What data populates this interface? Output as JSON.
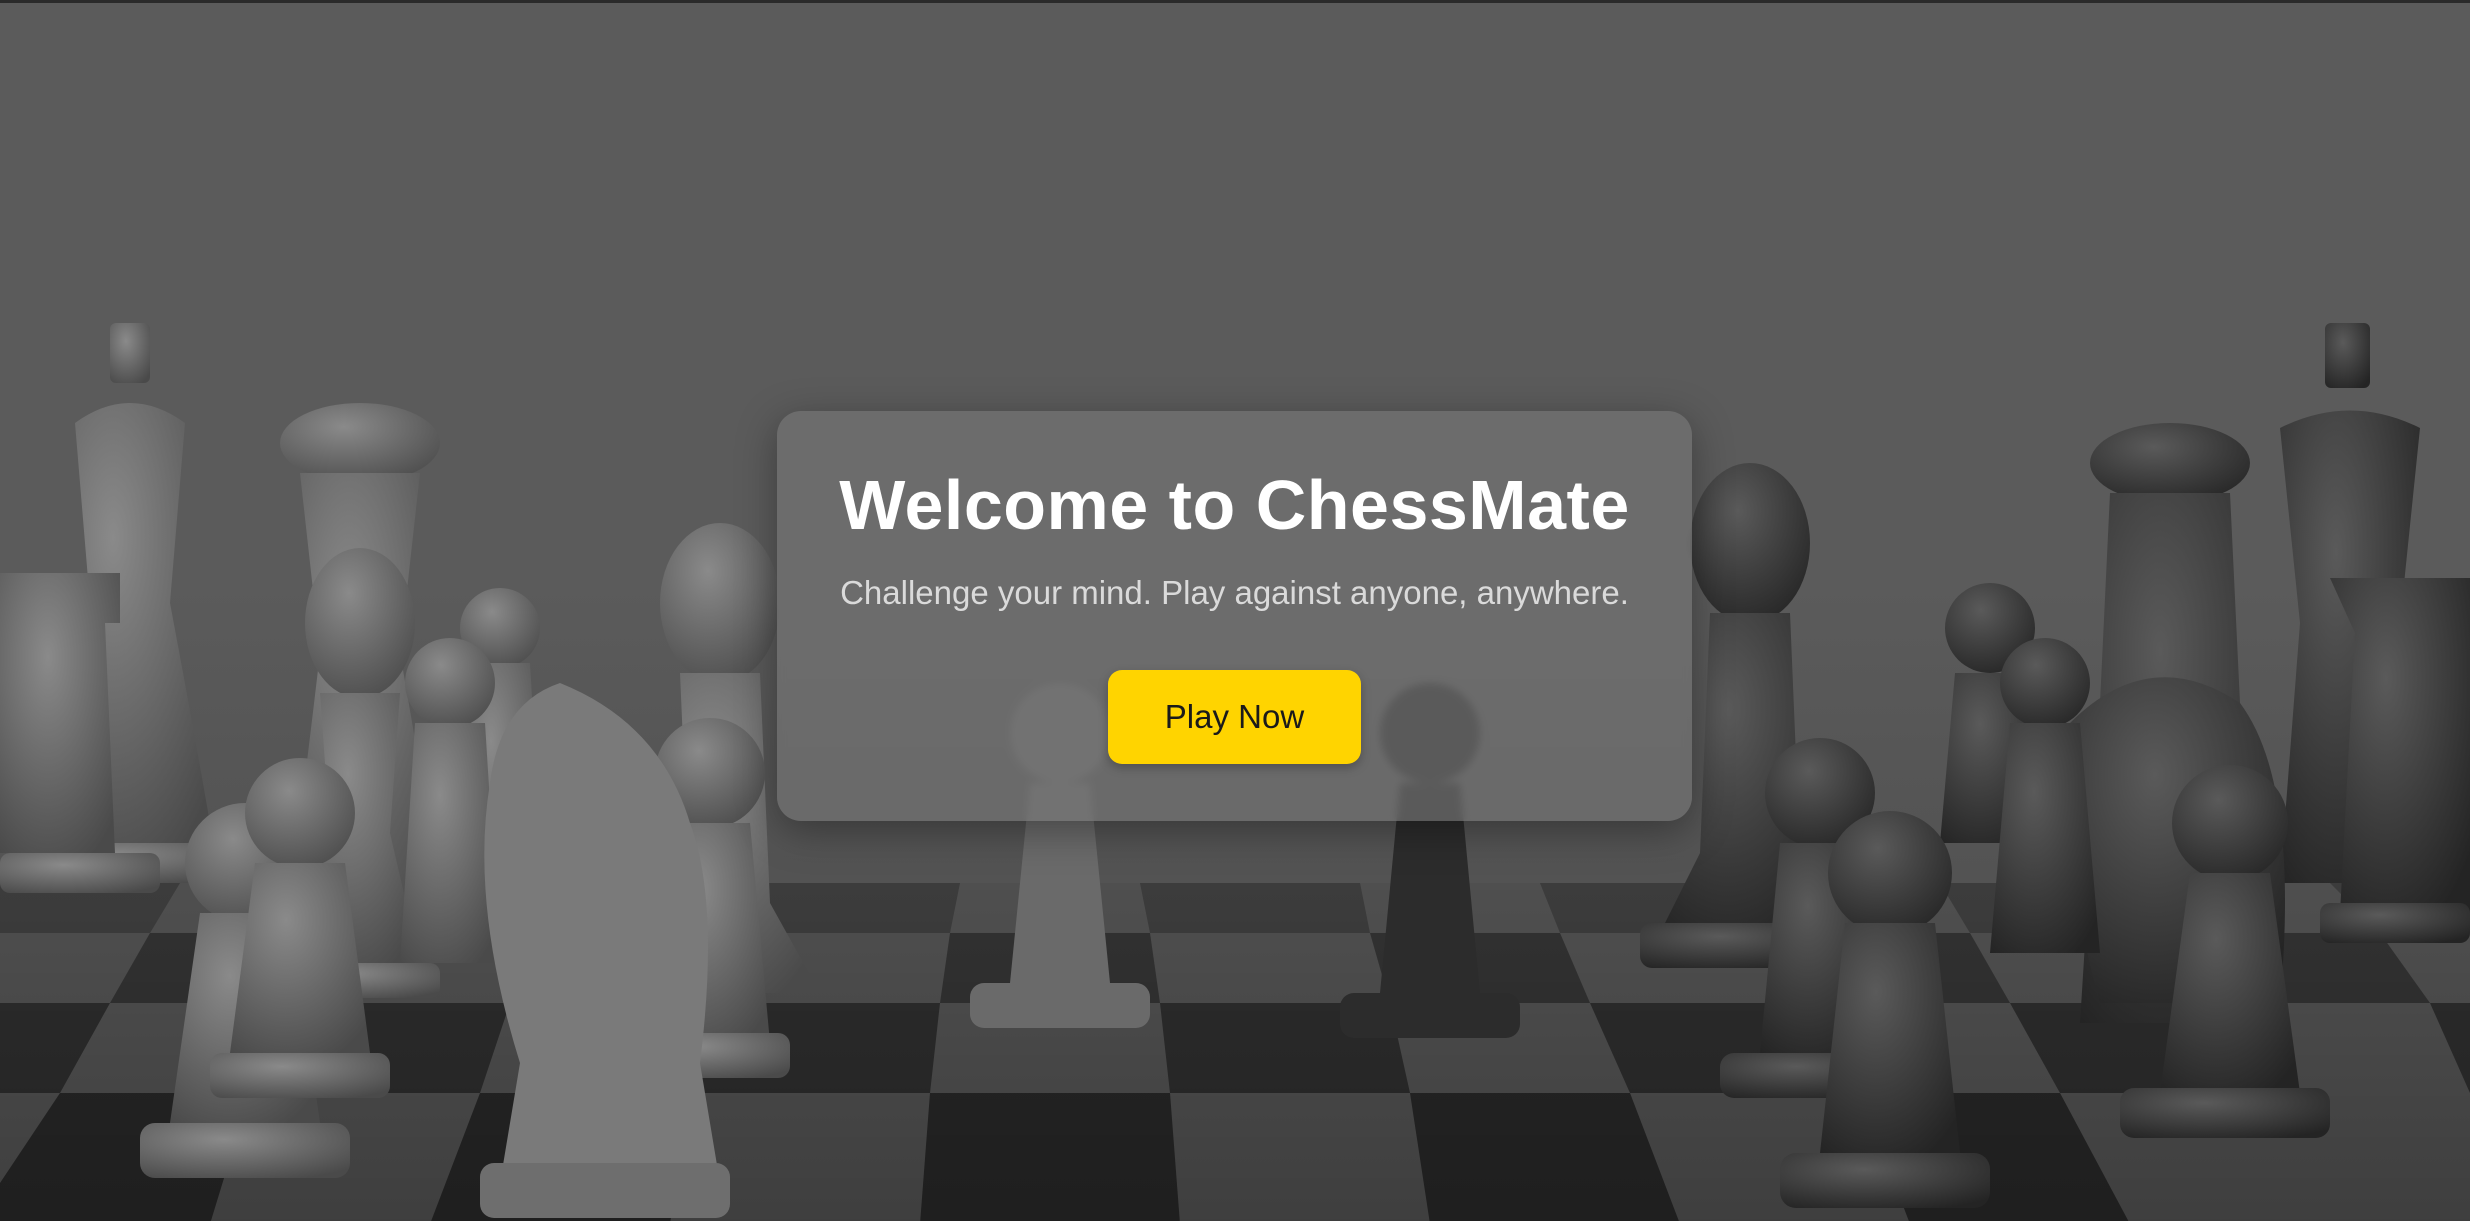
{
  "hero": {
    "title": "Welcome to ChessMate",
    "subtitle": "Challenge your mind. Play against anyone, anywhere.",
    "cta_label": "Play Now"
  },
  "background": {
    "description_icon": "chess-pieces-on-board",
    "tone": "#5b5b5b"
  },
  "colors": {
    "accent": "#ffd400",
    "title_text": "#ffffff",
    "subtitle_text": "#dadada"
  }
}
